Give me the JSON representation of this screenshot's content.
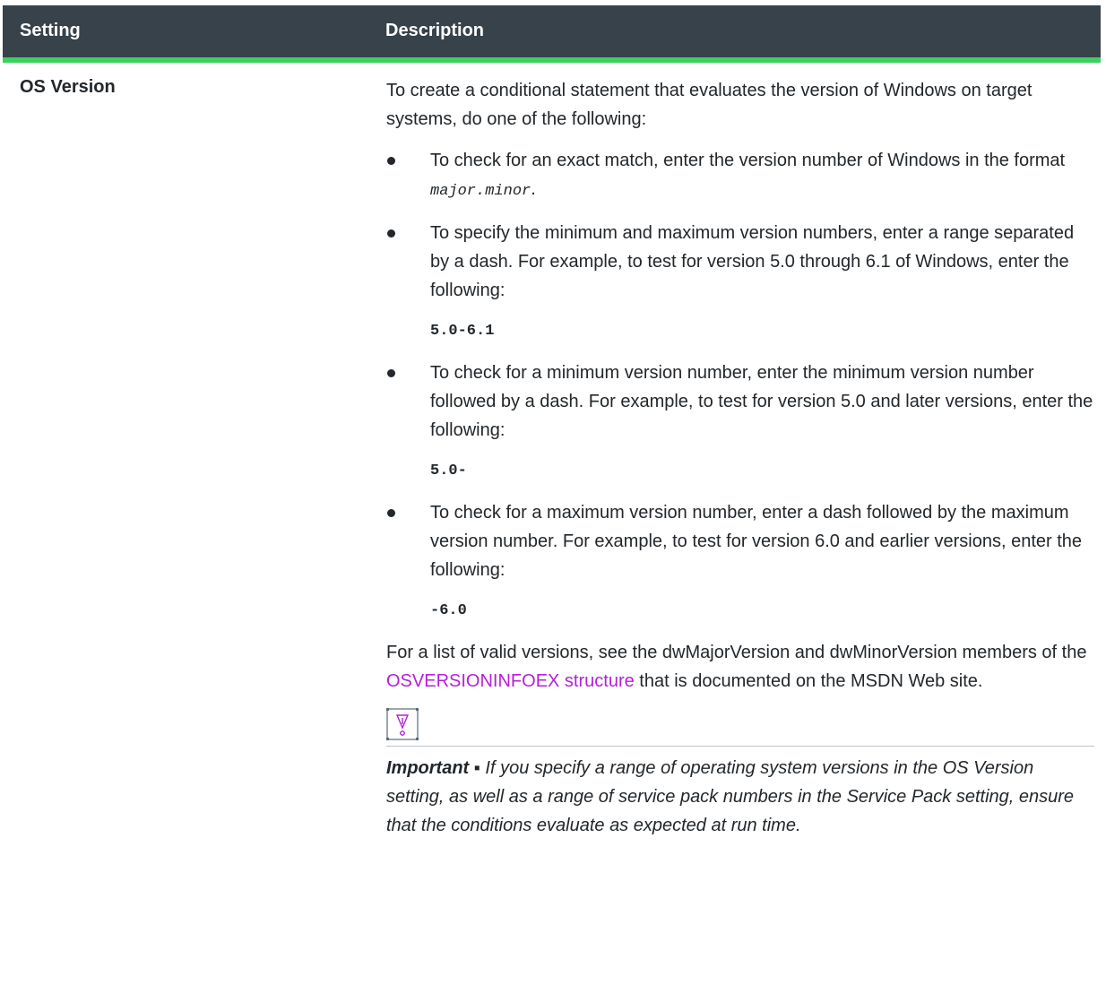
{
  "table": {
    "headers": {
      "setting": "Setting",
      "description": "Description"
    },
    "rows": [
      {
        "setting": "OS Version",
        "intro": "To create a conditional statement that evaluates the version of Windows on target systems, do one of the following:",
        "bullets": [
          {
            "text_before": "To check for an exact match, enter the version number of Windows in the format ",
            "format": "major.minor",
            "text_after": ".",
            "code": ""
          },
          {
            "text_before": "To specify the minimum and maximum version numbers, enter a range separated by a dash. For example, to test for version 5.0 through 6.1 of Windows, enter the following:",
            "code": "5.0-6.1"
          },
          {
            "text_before": "To check for a minimum version number, enter the minimum version number followed by a dash. For example, to test for version 5.0 and later versions, enter the following:",
            "code": "5.0-"
          },
          {
            "text_before": "To check for a maximum version number, enter a dash followed by the maximum version number. For example, to test for version 6.0 and earlier versions, enter the following:",
            "code": "-6.0"
          }
        ],
        "closing": {
          "before": "For a list of valid versions, see the dwMajorVersion and dwMinorVersion members of the ",
          "link": "OSVERSIONINFOEX structure",
          "after": " that is documented on the MSDN Web site."
        },
        "note": {
          "icon": "important-icon",
          "label": "Important ▪",
          "text": " If you specify a range of operating system versions in the OS Version setting, as well as a range of service pack numbers in the Service Pack setting, ensure that the conditions evaluate as expected at run time."
        }
      }
    ]
  },
  "colors": {
    "header_bg": "#37424a",
    "header_accent": "#3bd15e",
    "link": "#b520d8",
    "text": "#22272b"
  }
}
